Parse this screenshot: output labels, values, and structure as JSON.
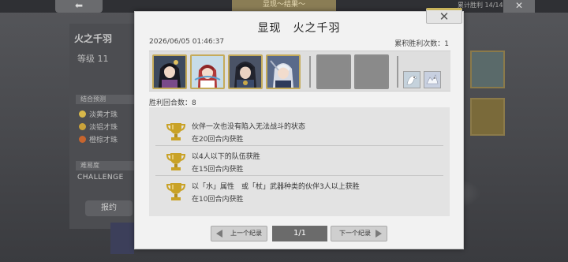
{
  "background": {
    "top_left_button": "⬅",
    "top_center_tab": "显现～结果～",
    "counter": "累计胜利 14/14",
    "top_right_button": "✕",
    "hero_name": "火之千羽",
    "level_label": "等级",
    "level_value": "11",
    "section_1": "结合预测",
    "gems": [
      "淡黄才珠",
      "淡铝才珠",
      "橙棕才珠"
    ],
    "section_2": "难易度",
    "difficulty": "CHALLENGE",
    "reward_button": "报约"
  },
  "modal": {
    "title": "显现　火之千羽",
    "close_label": "✕",
    "date": "2026/06/05 01:46:37",
    "win_count_label": "累积胜利次数：",
    "win_count_value": "1",
    "rounds_label": "胜利回合数：",
    "rounds_value": "8",
    "conditions": [
      {
        "title": "伙伴一次也没有陷入无法战斗的状态",
        "sub": "在20回合内获胜"
      },
      {
        "title": "以4人以下的队伍获胜",
        "sub": "在15回合内获胜"
      },
      {
        "title": "以「水」属性　或「杖」武器种类的伙伴3人以上获胜",
        "sub": "在10回合内获胜"
      }
    ],
    "pager": {
      "prev_label": "上一个纪录",
      "page": "1/1",
      "next_label": "下一个纪录"
    }
  },
  "colors": {
    "accent_gold": "#c5ab5a",
    "trophy_gold": "#c9a227",
    "page_indicator": "#6b6b6b"
  },
  "icons": {
    "character_portraits": [
      "black-hair-mage-portrait",
      "red-hair-girl-portrait",
      "dark-hair-swordsman-portrait",
      "white-hair-archer-portrait"
    ],
    "support_units": [
      "white-bird-icon",
      "white-dragon-icon"
    ],
    "condition_icon": "trophy-icon"
  }
}
